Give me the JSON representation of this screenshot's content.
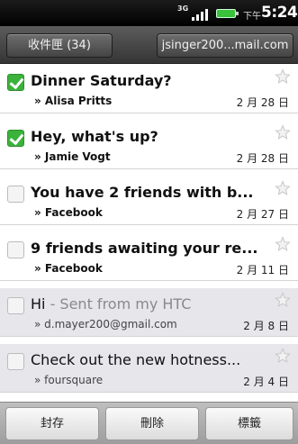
{
  "status_bar": {
    "network": "3G",
    "time_prefix": "下午",
    "time": "5:24",
    "battery_color": "#39c23a"
  },
  "header": {
    "inbox_label": "收件匣 (34)",
    "account_label": "jsinger200...mail.com"
  },
  "messages": [
    {
      "subject": "Dinner Saturday?",
      "preview": "",
      "from": "» Alisa Pritts",
      "date": "2 月 28 日",
      "checked": true,
      "read": false
    },
    {
      "subject": "Hey, what's up?",
      "preview": "",
      "from": "» Jamie Vogt",
      "date": "2 月 28 日",
      "checked": true,
      "read": false
    },
    {
      "subject": "You have 2 friends with b...",
      "preview": "",
      "from": "» Facebook",
      "date": "2 月 27 日",
      "checked": false,
      "read": false
    },
    {
      "subject": "9 friends awaiting your re...",
      "preview": "",
      "from": "» Facebook",
      "date": "2 月 11 日",
      "checked": false,
      "read": false
    },
    {
      "subject": "Hi",
      "preview": " - Sent from my HTC",
      "from": "» d.mayer200@gmail.com",
      "date": "2 月 8 日",
      "checked": false,
      "read": true
    },
    {
      "subject": "Check out the new hotness...",
      "preview": "",
      "from": "» foursquare",
      "date": "2 月 4 日",
      "checked": false,
      "read": true
    }
  ],
  "bottom_bar": {
    "archive_label": "封存",
    "delete_label": "刪除",
    "labels_label": "標籤"
  }
}
